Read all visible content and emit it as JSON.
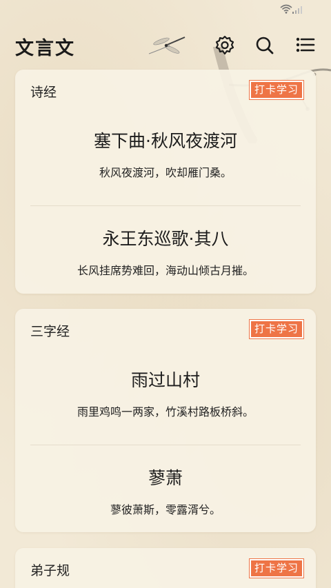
{
  "app": {
    "title": "文言文"
  },
  "header": {
    "icons": [
      "settings-icon",
      "search-icon",
      "menu-list-icon"
    ]
  },
  "sections": [
    {
      "category": "诗经",
      "checkin_label": "打卡学习",
      "poems": [
        {
          "title": "塞下曲·秋风夜渡河",
          "line": "秋风夜渡河，吹却雁门桑。"
        },
        {
          "title": "永王东巡歌·其八",
          "line": "长风挂席势难回，海动山倾古月摧。"
        }
      ]
    },
    {
      "category": "三字经",
      "checkin_label": "打卡学习",
      "poems": [
        {
          "title": "雨过山村",
          "line": "雨里鸡鸣一两家，竹溪村路板桥斜。"
        },
        {
          "title": "蓼萧",
          "line": "蓼彼萧斯，零露湑兮。"
        }
      ]
    },
    {
      "category": "弟子规",
      "checkin_label": "打卡学习",
      "poems": []
    }
  ],
  "colors": {
    "accent": "#ee7446",
    "background": "#f2e9d6",
    "card": "#f8f2e4"
  }
}
